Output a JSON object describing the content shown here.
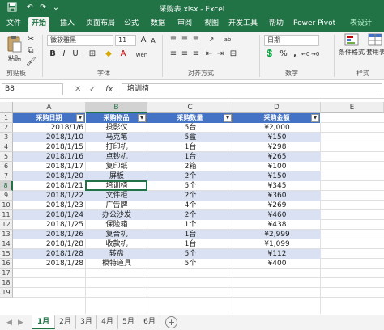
{
  "window": {
    "title": "采购表.xlsx  -  Excel"
  },
  "quick_access": {
    "save_icon": "save-icon",
    "undo_icon": "undo-icon",
    "redo_icon": "redo-icon",
    "customize_icon": "customize-icon"
  },
  "ribbon_tabs": [
    "文件",
    "开始",
    "插入",
    "页面布局",
    "公式",
    "数据",
    "审阅",
    "视图",
    "开发工具",
    "帮助",
    "Power Pivot",
    "表设计"
  ],
  "ribbon": {
    "paste_label": "粘贴",
    "clipboard_label": "剪贴板",
    "font_name": "微软雅黑",
    "font_size": "11",
    "grow_font": "A",
    "shrink_font": "A",
    "bold": "B",
    "italic": "I",
    "underline": "U",
    "font_color_glyph": "A",
    "wen": "wén",
    "font_group_label": "字体",
    "wrap_glyph": "ab",
    "alignment_label": "对齐方式",
    "number_format": "日期",
    "currency": "%",
    "comma": ",",
    "percent_glyph": "%",
    "number_label": "数字",
    "cond_format_label": "条件格式",
    "table_format_label": "套用表格格式",
    "styles_label": "样式"
  },
  "formula_bar": {
    "name_box": "B8",
    "cancel": "✕",
    "confirm": "✓",
    "fx": "fx",
    "value": "培训椅"
  },
  "columns": [
    "A",
    "B",
    "C",
    "D",
    "E"
  ],
  "row_numbers": [
    "1",
    "2",
    "3",
    "4",
    "5",
    "6",
    "7",
    "8",
    "9",
    "10",
    "11",
    "12",
    "13",
    "14",
    "15",
    "16",
    "17",
    "18",
    "19"
  ],
  "table": {
    "headers": [
      "采购日期",
      "采购物品",
      "采购数量",
      "采购金额"
    ],
    "filter_glyph": "▼",
    "rows": [
      [
        "2018/1/6",
        "投影仪",
        "5台",
        "¥2,000"
      ],
      [
        "2018/1/10",
        "马克笔",
        "5盒",
        "¥150"
      ],
      [
        "2018/1/15",
        "打印机",
        "1台",
        "¥298"
      ],
      [
        "2018/1/16",
        "点钞机",
        "1台",
        "¥265"
      ],
      [
        "2018/1/17",
        "复印纸",
        "2箱",
        "¥100"
      ],
      [
        "2018/1/20",
        "屏板",
        "2个",
        "¥150"
      ],
      [
        "2018/1/21",
        "培训椅",
        "5个",
        "¥345"
      ],
      [
        "2018/1/22",
        "文件柜",
        "2个",
        "¥360"
      ],
      [
        "2018/1/23",
        "广告牌",
        "4个",
        "¥269"
      ],
      [
        "2018/1/24",
        "办公沙发",
        "2个",
        "¥460"
      ],
      [
        "2018/1/25",
        "保险箱",
        "1个",
        "¥438"
      ],
      [
        "2018/1/26",
        "复合机",
        "1台",
        "¥2,999"
      ],
      [
        "2018/1/28",
        "收款机",
        "1台",
        "¥1,099"
      ],
      [
        "2018/1/28",
        "转盘",
        "5个",
        "¥112"
      ],
      [
        "2018/1/28",
        "模特道具",
        "5个",
        "¥400"
      ]
    ]
  },
  "sheets": [
    "1月",
    "2月",
    "3月",
    "4月",
    "5月",
    "6月"
  ],
  "active_sheet": "1月",
  "sheet_nav": {
    "prev": "◀",
    "next": "▶",
    "add": "+"
  },
  "colors": {
    "excel_green": "#217346",
    "table_header": "#4472c4",
    "band": "#d9e1f2"
  }
}
